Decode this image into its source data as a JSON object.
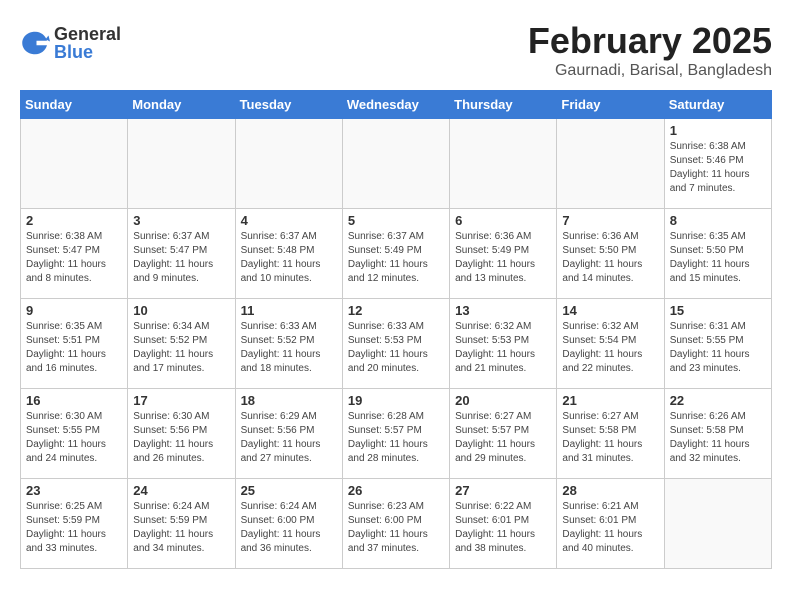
{
  "logo": {
    "general": "General",
    "blue": "Blue"
  },
  "header": {
    "month": "February 2025",
    "location": "Gaurnadi, Barisal, Bangladesh"
  },
  "weekdays": [
    "Sunday",
    "Monday",
    "Tuesday",
    "Wednesday",
    "Thursday",
    "Friday",
    "Saturday"
  ],
  "weeks": [
    [
      {
        "day": "",
        "info": ""
      },
      {
        "day": "",
        "info": ""
      },
      {
        "day": "",
        "info": ""
      },
      {
        "day": "",
        "info": ""
      },
      {
        "day": "",
        "info": ""
      },
      {
        "day": "",
        "info": ""
      },
      {
        "day": "1",
        "info": "Sunrise: 6:38 AM\nSunset: 5:46 PM\nDaylight: 11 hours and 7 minutes."
      }
    ],
    [
      {
        "day": "2",
        "info": "Sunrise: 6:38 AM\nSunset: 5:47 PM\nDaylight: 11 hours and 8 minutes."
      },
      {
        "day": "3",
        "info": "Sunrise: 6:37 AM\nSunset: 5:47 PM\nDaylight: 11 hours and 9 minutes."
      },
      {
        "day": "4",
        "info": "Sunrise: 6:37 AM\nSunset: 5:48 PM\nDaylight: 11 hours and 10 minutes."
      },
      {
        "day": "5",
        "info": "Sunrise: 6:37 AM\nSunset: 5:49 PM\nDaylight: 11 hours and 12 minutes."
      },
      {
        "day": "6",
        "info": "Sunrise: 6:36 AM\nSunset: 5:49 PM\nDaylight: 11 hours and 13 minutes."
      },
      {
        "day": "7",
        "info": "Sunrise: 6:36 AM\nSunset: 5:50 PM\nDaylight: 11 hours and 14 minutes."
      },
      {
        "day": "8",
        "info": "Sunrise: 6:35 AM\nSunset: 5:50 PM\nDaylight: 11 hours and 15 minutes."
      }
    ],
    [
      {
        "day": "9",
        "info": "Sunrise: 6:35 AM\nSunset: 5:51 PM\nDaylight: 11 hours and 16 minutes."
      },
      {
        "day": "10",
        "info": "Sunrise: 6:34 AM\nSunset: 5:52 PM\nDaylight: 11 hours and 17 minutes."
      },
      {
        "day": "11",
        "info": "Sunrise: 6:33 AM\nSunset: 5:52 PM\nDaylight: 11 hours and 18 minutes."
      },
      {
        "day": "12",
        "info": "Sunrise: 6:33 AM\nSunset: 5:53 PM\nDaylight: 11 hours and 20 minutes."
      },
      {
        "day": "13",
        "info": "Sunrise: 6:32 AM\nSunset: 5:53 PM\nDaylight: 11 hours and 21 minutes."
      },
      {
        "day": "14",
        "info": "Sunrise: 6:32 AM\nSunset: 5:54 PM\nDaylight: 11 hours and 22 minutes."
      },
      {
        "day": "15",
        "info": "Sunrise: 6:31 AM\nSunset: 5:55 PM\nDaylight: 11 hours and 23 minutes."
      }
    ],
    [
      {
        "day": "16",
        "info": "Sunrise: 6:30 AM\nSunset: 5:55 PM\nDaylight: 11 hours and 24 minutes."
      },
      {
        "day": "17",
        "info": "Sunrise: 6:30 AM\nSunset: 5:56 PM\nDaylight: 11 hours and 26 minutes."
      },
      {
        "day": "18",
        "info": "Sunrise: 6:29 AM\nSunset: 5:56 PM\nDaylight: 11 hours and 27 minutes."
      },
      {
        "day": "19",
        "info": "Sunrise: 6:28 AM\nSunset: 5:57 PM\nDaylight: 11 hours and 28 minutes."
      },
      {
        "day": "20",
        "info": "Sunrise: 6:27 AM\nSunset: 5:57 PM\nDaylight: 11 hours and 29 minutes."
      },
      {
        "day": "21",
        "info": "Sunrise: 6:27 AM\nSunset: 5:58 PM\nDaylight: 11 hours and 31 minutes."
      },
      {
        "day": "22",
        "info": "Sunrise: 6:26 AM\nSunset: 5:58 PM\nDaylight: 11 hours and 32 minutes."
      }
    ],
    [
      {
        "day": "23",
        "info": "Sunrise: 6:25 AM\nSunset: 5:59 PM\nDaylight: 11 hours and 33 minutes."
      },
      {
        "day": "24",
        "info": "Sunrise: 6:24 AM\nSunset: 5:59 PM\nDaylight: 11 hours and 34 minutes."
      },
      {
        "day": "25",
        "info": "Sunrise: 6:24 AM\nSunset: 6:00 PM\nDaylight: 11 hours and 36 minutes."
      },
      {
        "day": "26",
        "info": "Sunrise: 6:23 AM\nSunset: 6:00 PM\nDaylight: 11 hours and 37 minutes."
      },
      {
        "day": "27",
        "info": "Sunrise: 6:22 AM\nSunset: 6:01 PM\nDaylight: 11 hours and 38 minutes."
      },
      {
        "day": "28",
        "info": "Sunrise: 6:21 AM\nSunset: 6:01 PM\nDaylight: 11 hours and 40 minutes."
      },
      {
        "day": "",
        "info": ""
      }
    ]
  ]
}
